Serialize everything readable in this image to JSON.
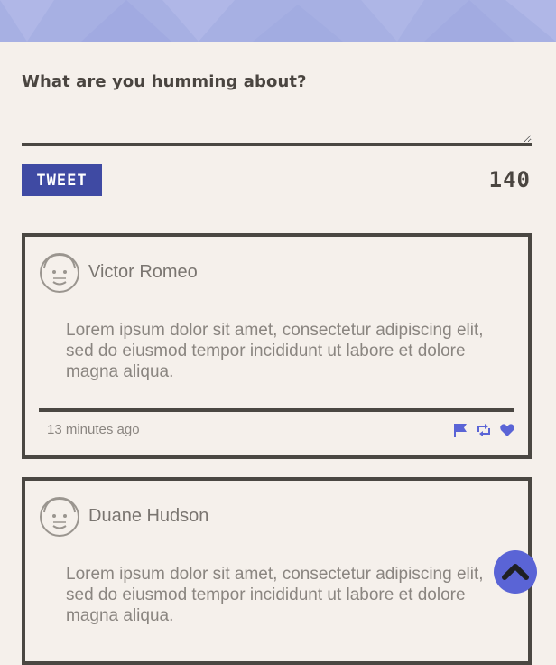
{
  "compose": {
    "prompt": "What are you humming about?",
    "value": "",
    "button_label": "Tweet",
    "char_count": "140"
  },
  "feed": [
    {
      "author": "Victor Romeo",
      "text": "Lorem ipsum dolor sit amet, consectetur adipiscing elit, sed do eiusmod tempor incididunt ut labore et dolore magna aliqua.",
      "time": "13 minutes ago",
      "actions": [
        "flag-icon",
        "retweet-icon",
        "heart-icon"
      ]
    },
    {
      "author": "Duane Hudson",
      "text": "Lorem ipsum dolor sit amet, consectetur adipiscing elit, sed do eiusmod tempor incididunt ut labore et dolore magna aliqua."
    }
  ],
  "colors": {
    "header": "#a7b0e3",
    "accent": "#3f4aa3",
    "action": "#5a64d6",
    "border": "#4a4742",
    "background": "#f5f0eb"
  },
  "icons": {
    "avatar": "face-avatar-icon",
    "scroll_top": "chevron-up-icon"
  }
}
